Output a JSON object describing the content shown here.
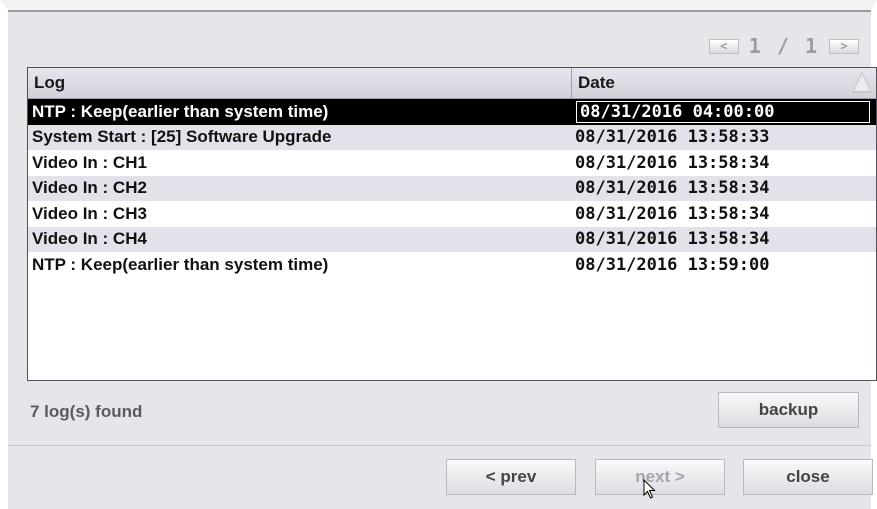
{
  "pager": {
    "prev_label": "<",
    "page_text": "1 / 1",
    "next_label": ">"
  },
  "table": {
    "headers": {
      "log": "Log",
      "date": "Date"
    },
    "rows": [
      {
        "log": "NTP : Keep(earlier than system time)",
        "date": "08/31/2016 04:00:00"
      },
      {
        "log": "System Start : [25] Software Upgrade",
        "date": "08/31/2016 13:58:33"
      },
      {
        "log": "Video In : CH1",
        "date": "08/31/2016 13:58:34"
      },
      {
        "log": "Video In : CH2",
        "date": "08/31/2016 13:58:34"
      },
      {
        "log": "Video In : CH3",
        "date": "08/31/2016 13:58:34"
      },
      {
        "log": "Video In : CH4",
        "date": "08/31/2016 13:58:34"
      },
      {
        "log": "NTP : Keep(earlier than system time)",
        "date": "08/31/2016 13:59:00"
      }
    ]
  },
  "footer": {
    "count_text": "7 log(s) found",
    "backup_label": "backup",
    "prev_label": "< prev",
    "next_label": "next >",
    "close_label": "close"
  }
}
